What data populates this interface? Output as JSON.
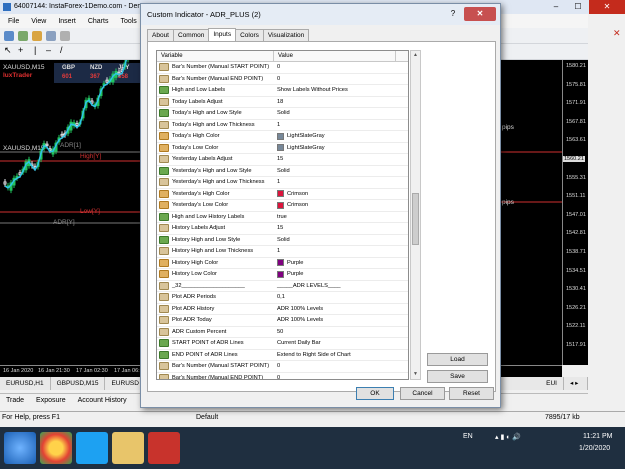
{
  "mt4": {
    "title": "64007144: InstaForex-1Demo.com - Demo",
    "menu": [
      "File",
      "View",
      "Insert",
      "Charts",
      "Tools"
    ],
    "chart_symbol": "XAUUSD,M15",
    "brand": "luxTrader",
    "quote_headers": [
      "GBP",
      "NZD",
      "JPY"
    ],
    "quote_values": [
      "601",
      "367",
      "358"
    ],
    "labels": {
      "adr_top": "ADR[1]",
      "high_y": "High[Y]",
      "low_y": "Low[Y]",
      "adr_bottom": "ADR[Y]",
      "pips_top": "pips",
      "pips_bottom": "pips"
    },
    "price_ticks": [
      "1580.21",
      "1575.81",
      "1571.91",
      "1567.81",
      "1563.61",
      "1560.21",
      "1555.31",
      "1551.11",
      "1547.01",
      "1542.81",
      "1538.71",
      "1534.51",
      "1530.41",
      "1526.21",
      "1522.11",
      "1517.91"
    ],
    "current_price": "1560.21",
    "time_ticks": [
      "16 Jan 2020",
      "16 Jan 21:30",
      "17 Jan 02:30",
      "17 Jan 06:"
    ],
    "symbol_tabs": [
      "EURUSD,H1",
      "GBPUSD,M15",
      "EURUSD",
      "EUI"
    ],
    "terminal_tabs": [
      "Trade",
      "Exposure",
      "Account History"
    ],
    "status_left": "For Help, press F1",
    "status_mid": "Default",
    "status_right": "7895/17 kb"
  },
  "taskbar": {
    "lang": "EN",
    "time": "11:21 PM",
    "date": "1/20/2020"
  },
  "dialog": {
    "title": "Custom Indicator - ADR_PLUS (2)",
    "help": "?",
    "close": "✕",
    "tabs": [
      "About",
      "Common",
      "Inputs",
      "Colors",
      "Visualization"
    ],
    "active_tab": "Inputs",
    "columns": [
      "Variable",
      "Value"
    ],
    "rows": [
      {
        "type": "int",
        "name": "Bar's Number (Manual START POINT)",
        "value": "0"
      },
      {
        "type": "int",
        "name": "Bar's Number (Manual END POINT)",
        "value": "0"
      },
      {
        "type": "enum",
        "name": "High and Low Labels",
        "value": "Show Labels Without Prices"
      },
      {
        "type": "int",
        "name": "Today Labels Adjust",
        "value": "18"
      },
      {
        "type": "enum",
        "name": "Today's High and Low Style",
        "value": "Solid"
      },
      {
        "type": "int",
        "name": "Today's High and Low Thickness",
        "value": "1"
      },
      {
        "type": "color",
        "name": "Today's High Color",
        "value": "LightSlateGray",
        "swatch": "#778899"
      },
      {
        "type": "color",
        "name": "Today's Low Color",
        "value": "LightSlateGray",
        "swatch": "#778899"
      },
      {
        "type": "int",
        "name": "Yesterday Labels Adjust",
        "value": "15"
      },
      {
        "type": "enum",
        "name": "Yesterday's High and Low Style",
        "value": "Solid"
      },
      {
        "type": "int",
        "name": "Yesterday's High and Low Thickness",
        "value": "1"
      },
      {
        "type": "color",
        "name": "Yesterday's High Color",
        "value": "Crimson",
        "swatch": "#dc143c"
      },
      {
        "type": "color",
        "name": "Yesterday's Low Color",
        "value": "Crimson",
        "swatch": "#dc143c"
      },
      {
        "type": "bool",
        "name": "High and Low History Labels",
        "value": "true"
      },
      {
        "type": "int",
        "name": "History Labels Adjust",
        "value": "15"
      },
      {
        "type": "enum",
        "name": "History High and Low Style",
        "value": "Solid"
      },
      {
        "type": "int",
        "name": "History High and Low Thickness",
        "value": "1"
      },
      {
        "type": "color",
        "name": "History High Color",
        "value": "Purple",
        "swatch": "#800080"
      },
      {
        "type": "color",
        "name": "History Low Color",
        "value": "Purple",
        "swatch": "#800080"
      },
      {
        "type": "str",
        "name": "_32____________________",
        "value": "_____ADR LEVELS____"
      },
      {
        "type": "int",
        "name": "Plot ADR Periods",
        "value": "0,1"
      },
      {
        "type": "str",
        "name": "Plot ADR History",
        "value": "ADR 100% Levels"
      },
      {
        "type": "str",
        "name": "Plot ADR Today",
        "value": "ADR 100% Levels"
      },
      {
        "type": "int",
        "name": "ADR Custom Percent",
        "value": "50"
      },
      {
        "type": "enum",
        "name": "START POINT of ADR Lines",
        "value": "Current Daily Bar"
      },
      {
        "type": "enum",
        "name": "END POINT of ADR Lines",
        "value": "Extend to Right Side of Chart"
      },
      {
        "type": "int",
        "name": "Bar's Number (Manual START POINT)",
        "value": "0"
      },
      {
        "type": "int",
        "name": "Bar's Number (Manual END POINT)",
        "value": "0"
      }
    ],
    "load_label": "Load",
    "save_label": "Save",
    "ok_label": "OK",
    "cancel_label": "Cancel",
    "reset_label": "Reset"
  }
}
